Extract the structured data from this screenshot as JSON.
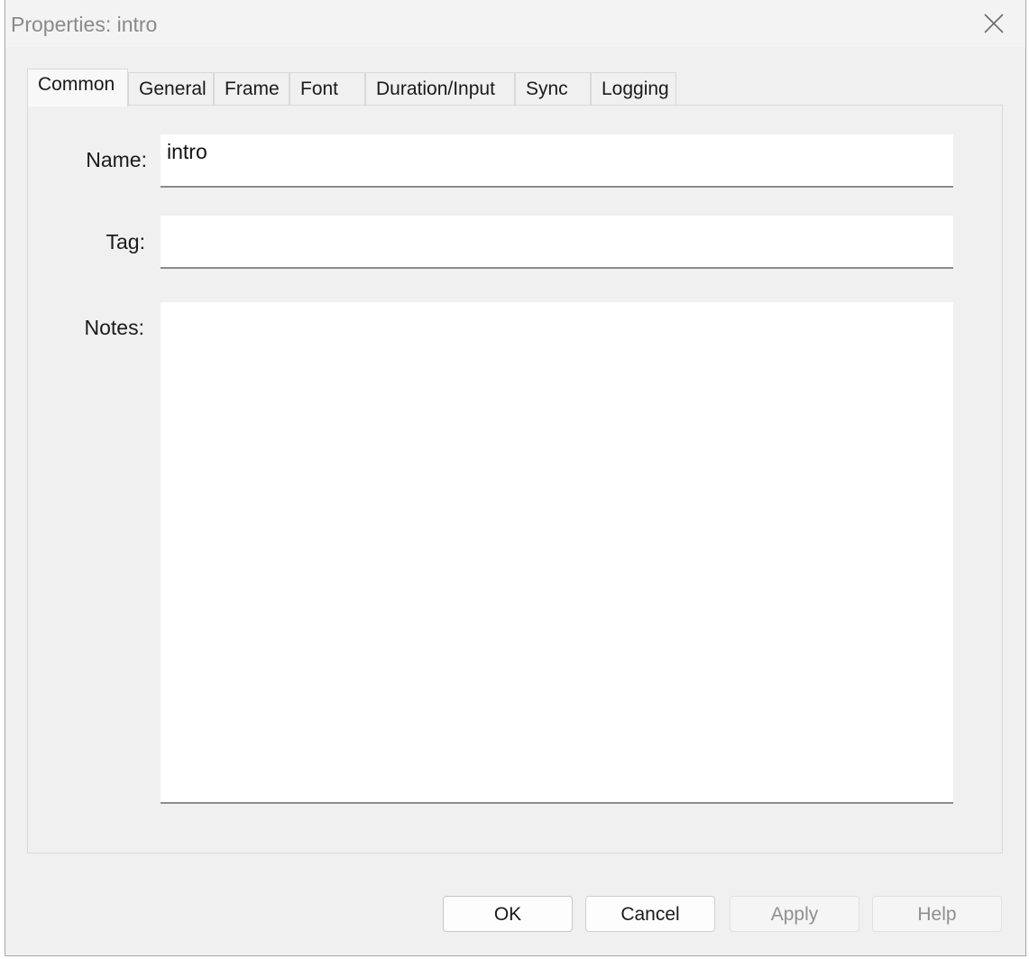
{
  "window": {
    "title": "Properties: intro"
  },
  "tabs": [
    {
      "label": "Common",
      "active": true
    },
    {
      "label": "General",
      "active": false
    },
    {
      "label": "Frame",
      "active": false
    },
    {
      "label": "Font",
      "active": false
    },
    {
      "label": "Duration/Input",
      "active": false
    },
    {
      "label": "Sync",
      "active": false
    },
    {
      "label": "Logging",
      "active": false
    }
  ],
  "form": {
    "name_label": "Name:",
    "name_value": "intro",
    "tag_label": "Tag:",
    "tag_value": "",
    "notes_label": "Notes:",
    "notes_value": ""
  },
  "buttons": {
    "ok": "OK",
    "cancel": "Cancel",
    "apply": "Apply",
    "help": "Help"
  },
  "colors": {
    "dialog_bg": "#f0f0f0",
    "disabled_text": "#8f8f8f"
  }
}
